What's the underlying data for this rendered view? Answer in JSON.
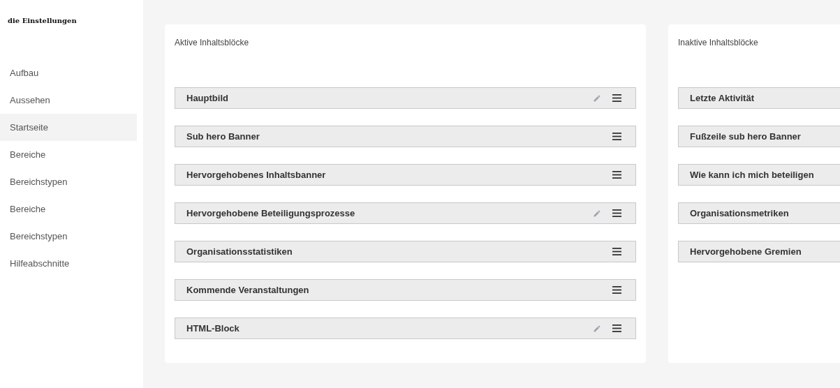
{
  "sidebar": {
    "title": "die Einstellungen",
    "items": [
      {
        "label": "Aufbau",
        "selected": false
      },
      {
        "label": "Aussehen",
        "selected": false
      },
      {
        "label": "Startseite",
        "selected": true
      },
      {
        "label": "Bereiche",
        "selected": false
      },
      {
        "label": "Bereichstypen",
        "selected": false
      },
      {
        "label": "Bereiche",
        "selected": false
      },
      {
        "label": "Bereichstypen",
        "selected": false
      },
      {
        "label": "Hilfeabschnitte",
        "selected": false
      }
    ]
  },
  "active_blocks": {
    "title": "Aktive Inhaltsblöcke",
    "items": [
      {
        "label": "Hauptbild",
        "editable": true
      },
      {
        "label": "Sub hero Banner",
        "editable": false
      },
      {
        "label": "Hervorgehobenes Inhaltsbanner",
        "editable": false
      },
      {
        "label": "Hervorgehobene Beteiligungsprozesse",
        "editable": true
      },
      {
        "label": "Organisationsstatistiken",
        "editable": false
      },
      {
        "label": "Kommende Veranstaltungen",
        "editable": false
      },
      {
        "label": "HTML-Block",
        "editable": true
      }
    ]
  },
  "inactive_blocks": {
    "title": "Inaktive Inhaltsblöcke",
    "items": [
      {
        "label": "Letzte Aktivität"
      },
      {
        "label": "Fußzeile sub hero Banner"
      },
      {
        "label": "Wie kann ich mich beteiligen"
      },
      {
        "label": "Organisationsmetriken"
      },
      {
        "label": "Hervorgehobene Gremien"
      }
    ]
  }
}
